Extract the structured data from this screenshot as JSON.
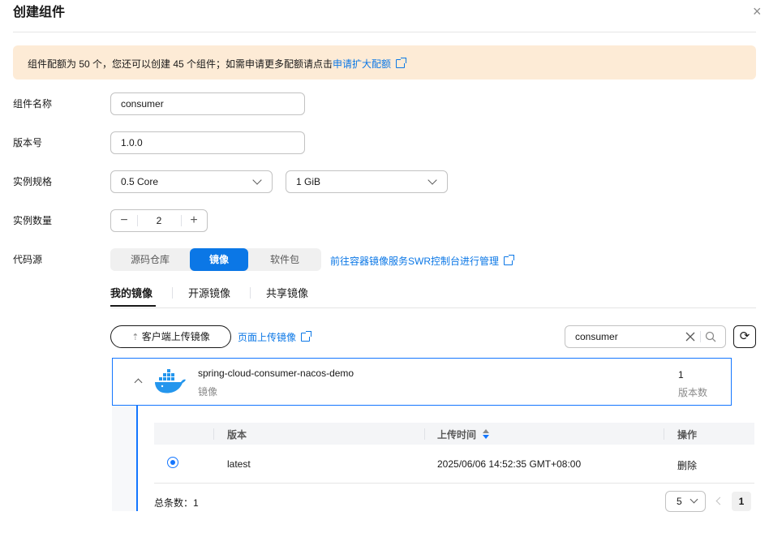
{
  "dialog": {
    "title": "创建组件",
    "close_symbol": "×"
  },
  "notice": {
    "text": "组件配额为 50 个，您还可以创建 45 个组件；如需申请更多配额请点击",
    "link": "申请扩大配额"
  },
  "form": {
    "name_label": "组件名称",
    "name_value": "consumer",
    "version_label": "版本号",
    "version_value": "1.0.0",
    "spec_label": "实例规格",
    "cpu_value": "0.5 Core",
    "memory_value": "1 GiB",
    "count_label": "实例数量",
    "count_value": "2",
    "minus": "−",
    "plus": "+",
    "source_label": "代码源",
    "source_options": [
      "源码仓库",
      "镜像",
      "软件包"
    ],
    "swr_link": "前往容器镜像服务SWR控制台进行管理"
  },
  "image_tabs": [
    "我的镜像",
    "开源镜像",
    "共享镜像"
  ],
  "toolbar": {
    "upload_client": "客户端上传镜像",
    "upload_page": "页面上传镜像",
    "search_value": "consumer",
    "refresh_symbol": "⟳"
  },
  "repo": {
    "name": "spring-cloud-consumer-nacos-demo",
    "type": "镜像",
    "version_count": "1",
    "version_count_label": "版本数"
  },
  "table": {
    "headers": [
      "版本",
      "上传时间",
      "操作"
    ],
    "rows": [
      {
        "version": "latest",
        "uploaded": "2025/06/06 14:52:35 GMT+08:00",
        "action": "删除"
      }
    ]
  },
  "pagination": {
    "total": "总条数：1",
    "page_size": "5",
    "current_page": "1"
  },
  "colors": {
    "accent": "#0b77e6",
    "notice_bg": "#fdebd6"
  }
}
